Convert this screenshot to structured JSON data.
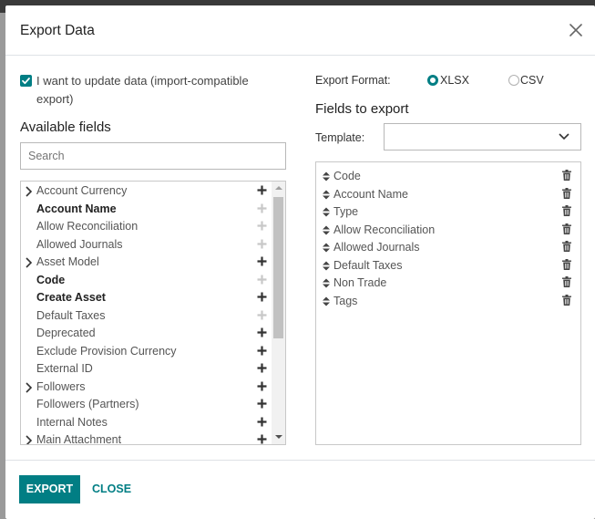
{
  "dialog": {
    "title": "Export Data",
    "import_compatible_checked": true,
    "import_compatible_label": "I want to update data (import-compatible export)"
  },
  "available": {
    "title": "Available fields",
    "search_placeholder": "Search",
    "fields": [
      {
        "label": "Account Currency",
        "expandable": true,
        "bold": false,
        "plus_active": true
      },
      {
        "label": "Account Name",
        "expandable": false,
        "bold": true,
        "plus_active": false
      },
      {
        "label": "Allow Reconciliation",
        "expandable": false,
        "bold": false,
        "plus_active": false
      },
      {
        "label": "Allowed Journals",
        "expandable": false,
        "bold": false,
        "plus_active": false
      },
      {
        "label": "Asset Model",
        "expandable": true,
        "bold": false,
        "plus_active": true
      },
      {
        "label": "Code",
        "expandable": false,
        "bold": true,
        "plus_active": false
      },
      {
        "label": "Create Asset",
        "expandable": false,
        "bold": true,
        "plus_active": true
      },
      {
        "label": "Default Taxes",
        "expandable": false,
        "bold": false,
        "plus_active": false
      },
      {
        "label": "Deprecated",
        "expandable": false,
        "bold": false,
        "plus_active": true
      },
      {
        "label": "Exclude Provision Currency",
        "expandable": false,
        "bold": false,
        "plus_active": true
      },
      {
        "label": "External ID",
        "expandable": false,
        "bold": false,
        "plus_active": true
      },
      {
        "label": "Followers",
        "expandable": true,
        "bold": false,
        "plus_active": true
      },
      {
        "label": "Followers (Partners)",
        "expandable": false,
        "bold": false,
        "plus_active": true
      },
      {
        "label": "Internal Notes",
        "expandable": false,
        "bold": false,
        "plus_active": true
      },
      {
        "label": "Main Attachment",
        "expandable": true,
        "bold": false,
        "plus_active": true
      }
    ]
  },
  "format": {
    "label": "Export Format:",
    "options": [
      {
        "label": "XLSX",
        "selected": true
      },
      {
        "label": "CSV",
        "selected": false
      }
    ]
  },
  "export": {
    "title": "Fields to export",
    "template_label": "Template:",
    "template_value": "",
    "fields": [
      "Code",
      "Account Name",
      "Type",
      "Allow Reconciliation",
      "Allowed Journals",
      "Default Taxes",
      "Non Trade",
      "Tags"
    ]
  },
  "footer": {
    "export_label": "EXPORT",
    "close_label": "CLOSE"
  },
  "colors": {
    "primary": "#017e84",
    "plus_active": "#333333",
    "plus_inactive": "#c8c8c8"
  }
}
